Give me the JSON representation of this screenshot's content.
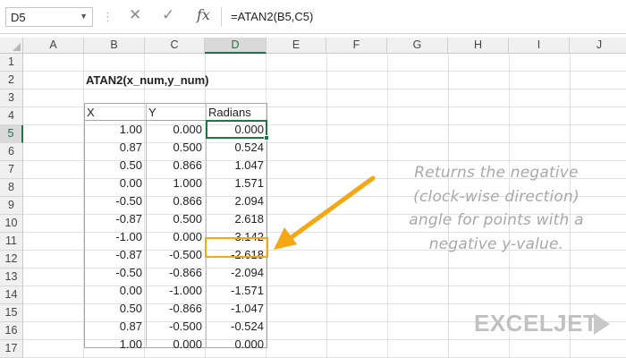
{
  "formula_bar": {
    "name_box": "D5",
    "cancel_icon": "✕",
    "enter_icon": "✓",
    "fx_label": "fx",
    "formula": "=ATAN2(B5,C5)"
  },
  "columns": [
    "A",
    "B",
    "C",
    "D",
    "E",
    "F",
    "G",
    "H",
    "I",
    "J"
  ],
  "rows": [
    "1",
    "2",
    "3",
    "4",
    "5",
    "6",
    "7",
    "8",
    "9",
    "10",
    "11",
    "12",
    "13",
    "14",
    "15",
    "16",
    "17"
  ],
  "active_cell": {
    "column": "D",
    "row": "5"
  },
  "sheet": {
    "title": "ATAN2(x_num,y_num)",
    "headers": {
      "x": "X",
      "y": "Y",
      "radians": "Radians"
    },
    "data": [
      {
        "x": "1.00",
        "y": "0.000",
        "radians": "0.000"
      },
      {
        "x": "0.87",
        "y": "0.500",
        "radians": "0.524"
      },
      {
        "x": "0.50",
        "y": "0.866",
        "radians": "1.047"
      },
      {
        "x": "0.00",
        "y": "1.000",
        "radians": "1.571"
      },
      {
        "x": "-0.50",
        "y": "0.866",
        "radians": "2.094"
      },
      {
        "x": "-0.87",
        "y": "0.500",
        "radians": "2.618"
      },
      {
        "x": "-1.00",
        "y": "0.000",
        "radians": "3.142"
      },
      {
        "x": "-0.87",
        "y": "-0.500",
        "radians": "-2.618"
      },
      {
        "x": "-0.50",
        "y": "-0.866",
        "radians": "-2.094"
      },
      {
        "x": "0.00",
        "y": "-1.000",
        "radians": "-1.571"
      },
      {
        "x": "0.50",
        "y": "-0.866",
        "radians": "-1.047"
      },
      {
        "x": "0.87",
        "y": "-0.500",
        "radians": "-0.524"
      },
      {
        "x": "1.00",
        "y": "0.000",
        "radians": "0.000"
      }
    ]
  },
  "annotation": {
    "lines": [
      "Returns the negative",
      "(clock-wise direction)",
      "angle for points with a",
      "negative y-value."
    ]
  },
  "logo": "EXCELJET",
  "colors": {
    "accent_green": "#217346",
    "highlight": "#f3a712",
    "note_text": "#a8a8a8"
  }
}
